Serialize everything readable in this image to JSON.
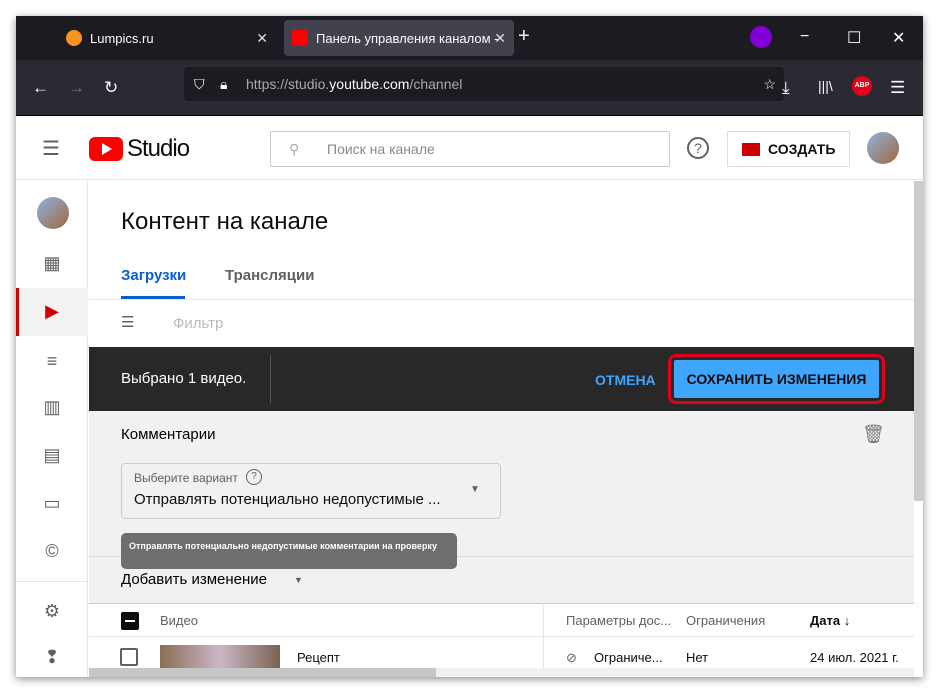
{
  "browser": {
    "tabs": [
      {
        "label": "Lumpics.ru"
      },
      {
        "label": "Панель управления каналом -"
      }
    ],
    "url_prefix": "https://studio.",
    "url_domain": "youtube.com",
    "url_path": "/channel",
    "abp": "ABP"
  },
  "header": {
    "logo": "Studio",
    "search_placeholder": "Поиск на канале",
    "create": "СОЗДАТЬ"
  },
  "page": {
    "title": "Контент на канале",
    "tabs": [
      "Загрузки",
      "Трансляции"
    ],
    "filter": "Фильтр"
  },
  "selection": {
    "text": "Выбрано 1 видео.",
    "cancel": "ОТМЕНА",
    "save": "СОХРАНИТЬ ИЗМЕНЕНИЯ"
  },
  "edit": {
    "section": "Комментарии",
    "dropdown_label": "Выберите вариант",
    "dropdown_value": "Отправлять потенциально недопустимые ...",
    "tooltip": "Отправлять потенциально недопустимые комментарии на проверку",
    "add_change": "Добавить изменение"
  },
  "table": {
    "headers": [
      "Видео",
      "Параметры дос...",
      "Ограничения",
      "Дата ↓"
    ],
    "rows": [
      {
        "title": "Рецепт",
        "visibility": "Ограниче...",
        "restrictions": "Нет",
        "date": "24 июл. 2021 г."
      }
    ]
  },
  "colors": {
    "accent": "#3ea6ff",
    "highlight": "#e0001a",
    "brand": "#ff0000"
  }
}
